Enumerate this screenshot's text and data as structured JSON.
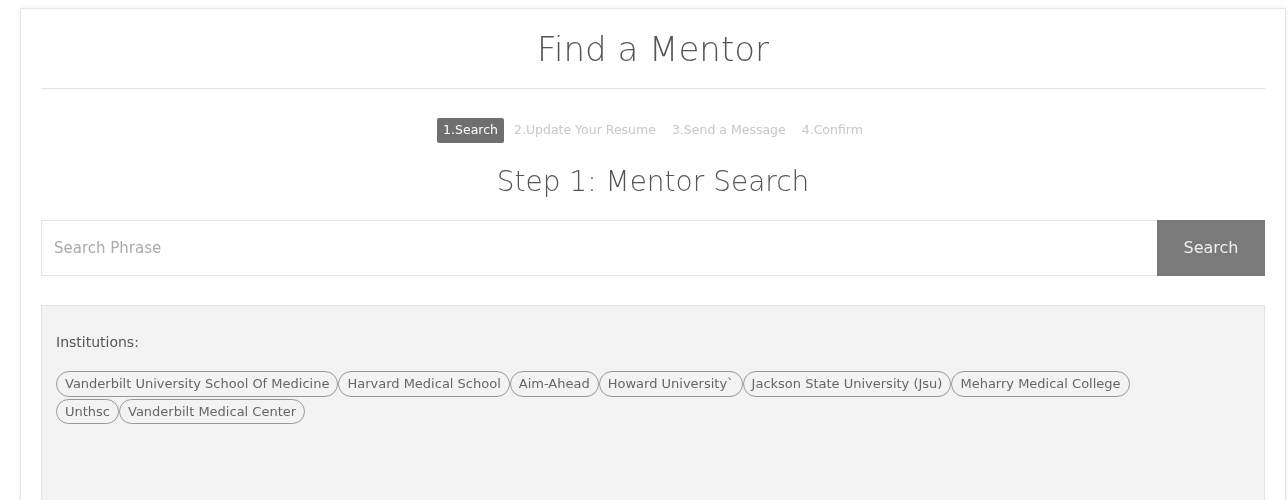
{
  "title": "Find a Mentor",
  "steps": [
    {
      "label": "1.Search",
      "selected": true
    },
    {
      "label": "2.Update Your Resume",
      "selected": false
    },
    {
      "label": "3.Send a Message",
      "selected": false
    },
    {
      "label": "4.Confirm",
      "selected": false
    }
  ],
  "step_heading": "Step 1: Mentor Search",
  "search": {
    "placeholder": "Search Phrase",
    "button": "Search"
  },
  "filters": {
    "label": "Institutions:",
    "tags": [
      "Vanderbilt University School Of Medicine",
      "Harvard Medical School",
      "Aim-Ahead",
      "Howard University`",
      "Jackson State University (Jsu)",
      "Meharry Medical College",
      "Unthsc",
      "Vanderbilt Medical Center"
    ]
  }
}
